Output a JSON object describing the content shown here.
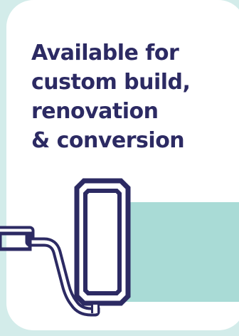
{
  "headline": {
    "lines": [
      "Available for",
      "custom build,",
      "renovation",
      "& conversion"
    ]
  },
  "colors": {
    "ink": "#2c2a63",
    "paint_swatch": "#a9dbd6",
    "background": "#d3ecea",
    "card": "#ffffff"
  },
  "icon": "paint-roller-icon"
}
